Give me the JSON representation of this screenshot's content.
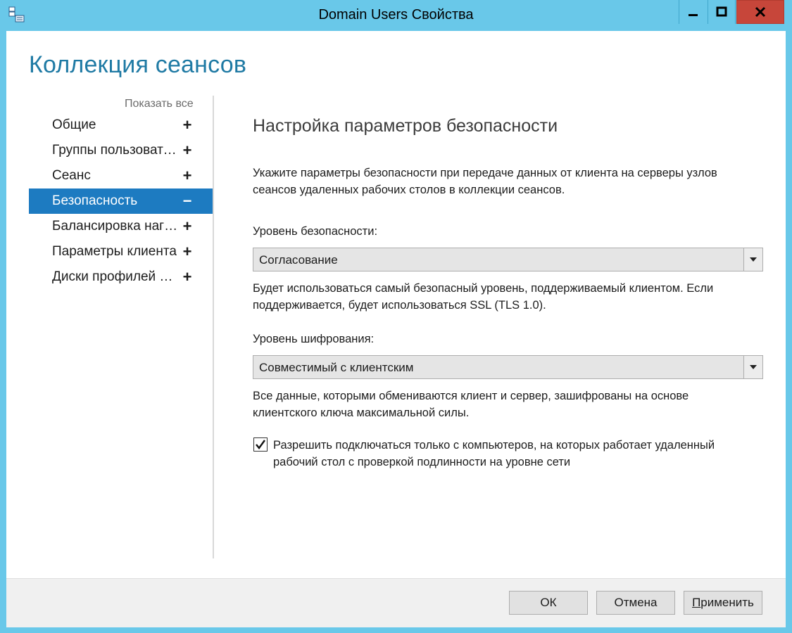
{
  "window": {
    "title": "Domain Users Свойства",
    "icons": {
      "app": "server-properties-icon",
      "minimize": "minimize-icon",
      "maximize": "maximize-icon",
      "close": "close-icon"
    },
    "colors": {
      "titlebar": "#69c8e9",
      "close": "#c7463a",
      "heading": "#1f7aa4",
      "selection": "#1d7bc1"
    }
  },
  "page": {
    "heading": "Коллекция сеансов"
  },
  "sidebar": {
    "show_all": "Показать все",
    "items": [
      {
        "label": "Общие",
        "sign": "+",
        "active": false
      },
      {
        "label": "Группы пользователей",
        "sign": "+",
        "active": false
      },
      {
        "label": "Сеанс",
        "sign": "+",
        "active": false
      },
      {
        "label": "Безопасность",
        "sign": "−",
        "active": true
      },
      {
        "label": "Балансировка нагрузки",
        "sign": "+",
        "active": false
      },
      {
        "label": "Параметры клиента",
        "sign": "+",
        "active": false
      },
      {
        "label": "Диски профилей пользователей",
        "sign": "+",
        "active": false
      }
    ]
  },
  "content": {
    "title": "Настройка параметров безопасности",
    "intro_line1": "Укажите параметры безопасности при передаче данных от клиента на серверы узлов",
    "intro_line2": "сеансов удаленных рабочих столов в коллекции сеансов.",
    "security_level_label": "Уровень безопасности:",
    "security_level_value": "Согласование",
    "security_desc_line1": "Будет использоваться самый безопасный уровень, поддерживаемый клиентом. Если",
    "security_desc_line2": "поддерживается, будет использоваться SSL (TLS 1.0).",
    "encryption_level_label": "Уровень шифрования:",
    "encryption_level_value": "Совместимый с клиентским",
    "encryption_desc_line1": "Все данные, которыми обмениваются клиент и сервер, зашифрованы на основе",
    "encryption_desc_line2": "клиентского ключа максимальной силы.",
    "nla_checkbox_checked": true,
    "nla_label_line1": "Разрешить подключаться только с компьютеров, на которых работает удаленный",
    "nla_label_line2": "рабочий стол с проверкой подлинности на уровне сети"
  },
  "footer": {
    "ok_label": "ОК",
    "cancel_label": "Отмена",
    "apply_label_mnemonic": "П",
    "apply_label_rest": "рименить"
  }
}
